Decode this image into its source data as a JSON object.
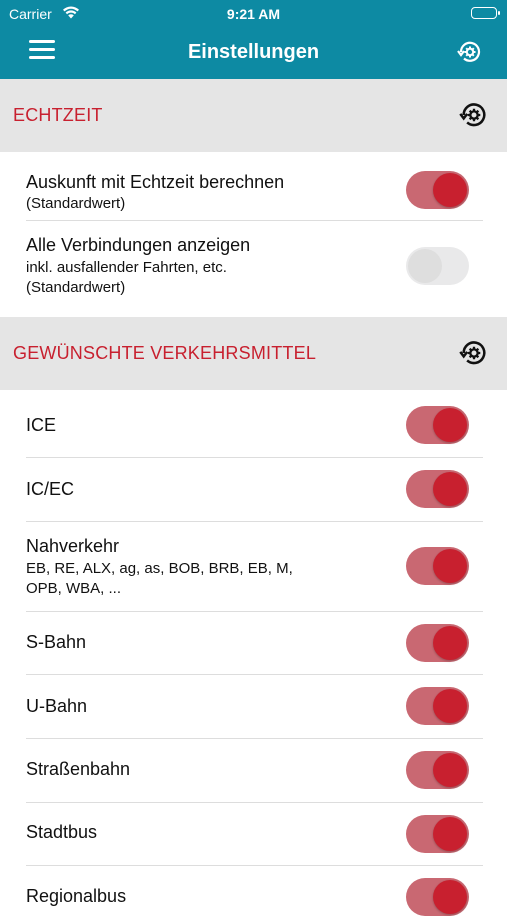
{
  "status_bar": {
    "carrier": "Carrier",
    "time": "9:21 AM"
  },
  "header": {
    "title": "Einstellungen",
    "menu_icon": "hamburger-menu-icon",
    "reset_icon": "reset-settings-icon"
  },
  "sections": [
    {
      "title": "ECHTZEIT",
      "items": [
        {
          "label": "Auskunft mit Echtzeit berechnen",
          "sublines": [
            "(Standardwert)"
          ],
          "enabled": true
        },
        {
          "label": "Alle Verbindungen anzeigen",
          "sublines": [
            "inkl. ausfallender Fahrten, etc.",
            "(Standardwert)"
          ],
          "enabled": false
        }
      ]
    },
    {
      "title": "GEWÜNSCHTE VERKEHRSMITTEL",
      "items": [
        {
          "label": "ICE",
          "enabled": true
        },
        {
          "label": "IC/EC",
          "enabled": true
        },
        {
          "label": "Nahverkehr",
          "sublines": [
            "EB, RE, ALX, ag, as, BOB, BRB, EB, M,",
            "OPB, WBA, ..."
          ],
          "enabled": true
        },
        {
          "label": "S-Bahn",
          "enabled": true
        },
        {
          "label": "U-Bahn",
          "enabled": true
        },
        {
          "label": "Straßenbahn",
          "enabled": true
        },
        {
          "label": "Stadtbus",
          "enabled": true
        },
        {
          "label": "Regionalbus",
          "enabled": true
        }
      ]
    }
  ],
  "colors": {
    "header": "#0d8aa3",
    "accent": "#c8202f",
    "section_bg": "#e5e5e5"
  }
}
